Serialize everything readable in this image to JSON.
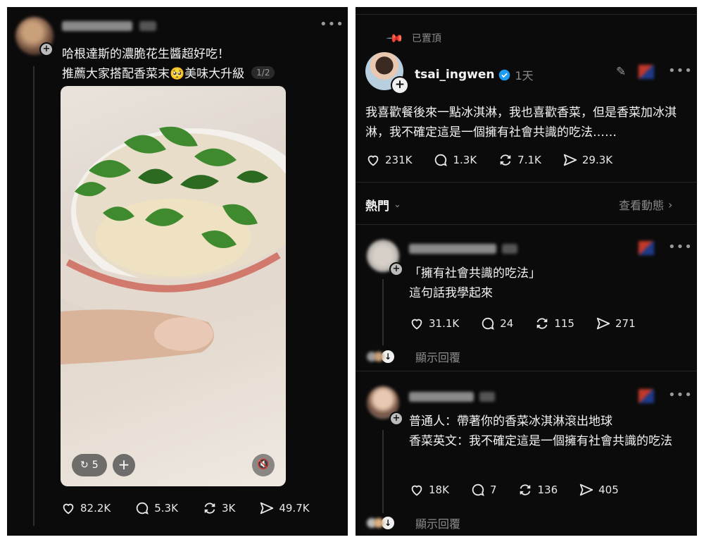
{
  "left": {
    "post_text_1": "哈根達斯的濃脆花生醬超好吃！",
    "post_text_2": "推薦大家搭配香菜末🥺美味大升級",
    "page_indicator": "1/2",
    "repost_count": "5",
    "stats": {
      "likes": "82.2K",
      "comments": "5.3K",
      "reposts": "3K",
      "shares": "49.7K"
    }
  },
  "right": {
    "pinned_label": "已置頂",
    "author": "tsai_ingwen",
    "time_ago": "1天",
    "post_text": "我喜歡餐後來一點冰淇淋，我也喜歡香菜，但是香菜加冰淇淋，我不確定這是一個擁有社會共識的吃法……",
    "stats": {
      "likes": "231K",
      "comments": "1.3K",
      "reposts": "7.1K",
      "shares": "29.3K"
    },
    "sort_label": "熱門",
    "view_activity": "查看動態",
    "replies": [
      {
        "text": "「擁有社會共識的吃法」\n這句話我學起來",
        "stats": {
          "likes": "31.1K",
          "comments": "24",
          "reposts": "115",
          "shares": "271"
        },
        "show_replies": "顯示回覆"
      },
      {
        "text": "普通人：帶著你的香菜冰淇淋滾出地球\n香菜英文：我不確定這是一個擁有社會共識的吃法",
        "stats": {
          "likes": "18K",
          "comments": "7",
          "reposts": "136",
          "shares": "405"
        },
        "show_replies": "顯示回覆"
      }
    ]
  },
  "colors": {
    "background": "#0b0b0b",
    "text": "#f3f3f3",
    "muted": "#8b8b8b",
    "verified": "#1d9bf0",
    "cilantro": "#3f8a2e"
  }
}
